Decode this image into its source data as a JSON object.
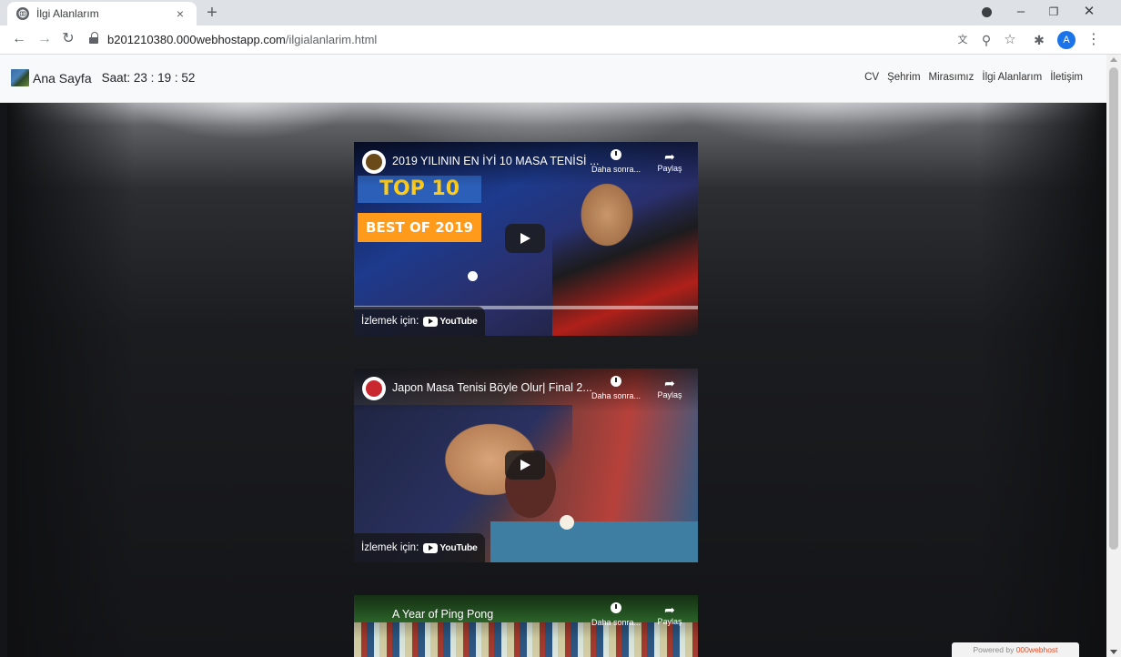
{
  "browser": {
    "tab_title": "İlgi Alanlarım",
    "tab_close": "×",
    "new_tab": "+",
    "url_host": "b201210380.000webhostapp.com",
    "url_path": "/ilgialanlarim.html",
    "avatar_letter": "A",
    "icons": [
      "back-arrow-icon",
      "forward-arrow-icon",
      "reload-icon",
      "lock-icon",
      "translate-icon",
      "zoom-icon",
      "star-icon",
      "extensions-icon",
      "menu-icon"
    ]
  },
  "site": {
    "brand": "Ana Sayfa",
    "clock": "Saat: 23 : 19 : 52",
    "menu": [
      {
        "label": "CV"
      },
      {
        "label": "Şehrim"
      },
      {
        "label": "Mirasımız"
      },
      {
        "label": "İlgi Alanlarım"
      },
      {
        "label": "İletişim"
      }
    ]
  },
  "videos": [
    {
      "title": "2019 YILININ EN İYİ 10 MASA TENİSİ ...",
      "watch_later": "Daha sonra...",
      "share": "Paylaş",
      "watch_on": "İzlemek için:",
      "thumb_text_1": "TOP 10",
      "thumb_text_2": "BEST OF 2019"
    },
    {
      "title": "Japon Masa Tenisi Böyle Olur| Final 2...",
      "watch_later": "Daha sonra...",
      "share": "Paylaş",
      "watch_on": "İzlemek için:"
    },
    {
      "title": "A Year of Ping Pong",
      "watch_later": "Daha sonra...",
      "share": "Paylaş"
    }
  ],
  "youtube_word": "YouTube",
  "powered_by": "Powered by",
  "host_brand": "000webhost",
  "colors": {
    "accent_blue": "#1a73e8",
    "page_bg": "#141518",
    "nav_bg": "#f8f9fa"
  }
}
